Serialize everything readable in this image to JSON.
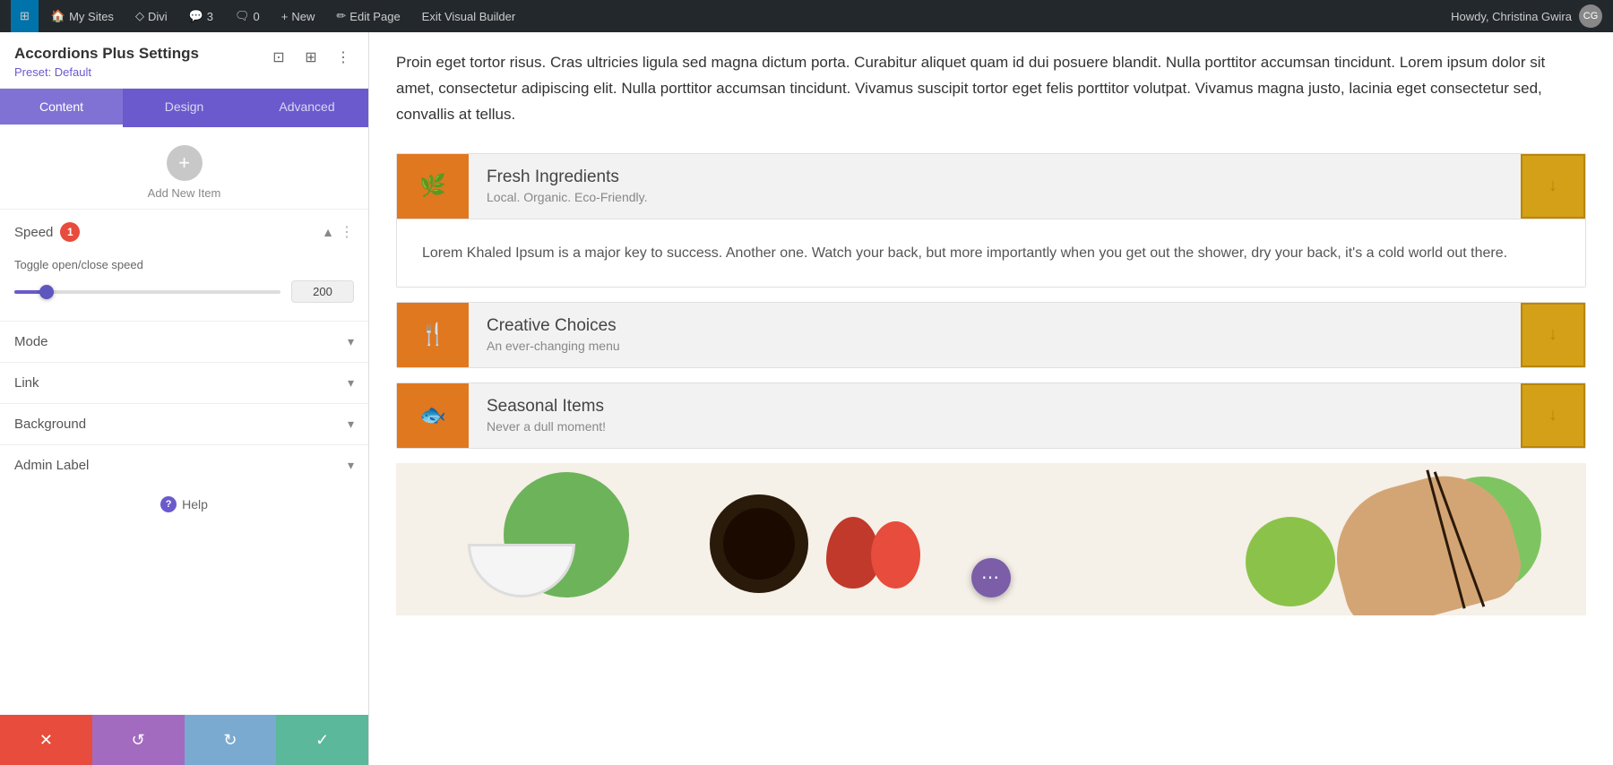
{
  "adminBar": {
    "items": [
      {
        "id": "wp-logo",
        "icon": "⊞",
        "label": ""
      },
      {
        "id": "my-sites",
        "icon": "🏠",
        "label": "My Sites"
      },
      {
        "id": "divi",
        "icon": "◇",
        "label": "Divi"
      },
      {
        "id": "comments",
        "icon": "💬",
        "label": "3"
      },
      {
        "id": "comment-count",
        "icon": "🗨",
        "label": "0"
      },
      {
        "id": "new",
        "icon": "+",
        "label": "New"
      },
      {
        "id": "edit-page",
        "icon": "✏",
        "label": "Edit Page"
      },
      {
        "id": "exit-builder",
        "label": "Exit Visual Builder"
      }
    ],
    "userGreeting": "Howdy, Christina Gwira"
  },
  "sidebar": {
    "title": "Accordions Plus Settings",
    "preset": "Preset: Default",
    "tabs": [
      {
        "id": "content",
        "label": "Content",
        "active": true
      },
      {
        "id": "design",
        "label": "Design",
        "active": false
      },
      {
        "id": "advanced",
        "label": "Advanced",
        "active": false
      }
    ],
    "addNewItem": {
      "label": "Add New Item"
    },
    "sections": [
      {
        "id": "speed",
        "title": "Speed",
        "badge": "1",
        "expanded": true,
        "fields": [
          {
            "id": "toggle-speed",
            "label": "Toggle open/close speed",
            "type": "slider",
            "value": "200",
            "min": 0,
            "max": 2000
          }
        ]
      },
      {
        "id": "mode",
        "title": "Mode",
        "expanded": false
      },
      {
        "id": "link",
        "title": "Link",
        "expanded": false
      },
      {
        "id": "background",
        "title": "Background",
        "expanded": false
      },
      {
        "id": "admin-label",
        "title": "Admin Label",
        "expanded": false
      }
    ],
    "help": "Help",
    "actions": [
      {
        "id": "cancel",
        "icon": "✕",
        "type": "cancel"
      },
      {
        "id": "undo",
        "icon": "↺",
        "type": "undo"
      },
      {
        "id": "redo",
        "icon": "↻",
        "type": "redo"
      },
      {
        "id": "save",
        "icon": "✓",
        "type": "save"
      }
    ]
  },
  "pageContent": {
    "introText": "Proin eget tortor risus. Cras ultricies ligula sed magna dictum porta. Curabitur aliquet quam id dui posuere blandit. Nulla porttitor accumsan tincidunt. Lorem ipsum dolor sit amet, consectetur adipiscing elit. Nulla porttitor accumsan tincidunt. Vivamus suscipit tortor eget felis porttitor volutpat. Vivamus magna justo, lacinia eget consectetur sed, convallis at tellus.",
    "accordions": [
      {
        "id": "fresh-ingredients",
        "icon": "🌿",
        "title": "Fresh Ingredients",
        "subtitle": "Local. Organic. Eco-Friendly.",
        "expanded": true,
        "body": "Lorem Khaled Ipsum is a major key to success. Another one. Watch your back, but more importantly when you get out the shower, dry your back, it's a cold world out there."
      },
      {
        "id": "creative-choices",
        "icon": "🍴",
        "title": "Creative Choices",
        "subtitle": "An ever-changing menu",
        "expanded": false,
        "body": ""
      },
      {
        "id": "seasonal-items",
        "icon": "🐟",
        "title": "Seasonal Items",
        "subtitle": "Never a dull moment!",
        "expanded": false,
        "body": ""
      }
    ],
    "floatingBtn": {
      "label": "⋯"
    }
  }
}
